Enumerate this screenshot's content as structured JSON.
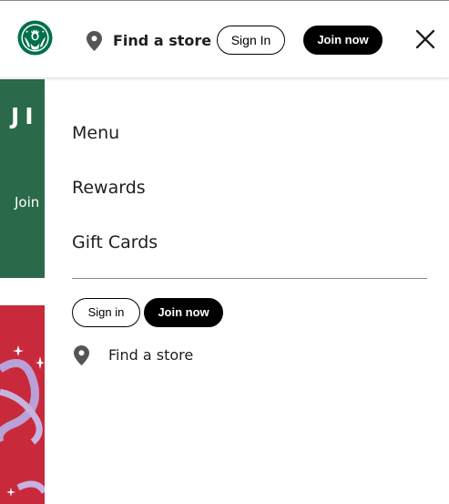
{
  "header": {
    "logo_icon": "starbucks-siren-logo",
    "location_icon": "location-pin-icon",
    "find_store_label": "Find a store",
    "sign_in_label": "Sign In",
    "join_now_label": "Join now",
    "close_icon": "close-x-icon"
  },
  "background_page": {
    "hero_heading_partial": "JI",
    "hero_join_partial": "Join"
  },
  "panel": {
    "nav_items": [
      "Menu",
      "Rewards",
      "Gift Cards"
    ],
    "sign_in_label": "Sign in",
    "join_now_label": "Join now",
    "location_icon": "location-pin-icon",
    "find_store_label": "Find a store"
  },
  "colors": {
    "brand_green": "#00704a",
    "hero_green": "#2a6a4a",
    "promo_red": "#c82a3c",
    "text": "#1e1e1e",
    "button_black": "#000000"
  }
}
